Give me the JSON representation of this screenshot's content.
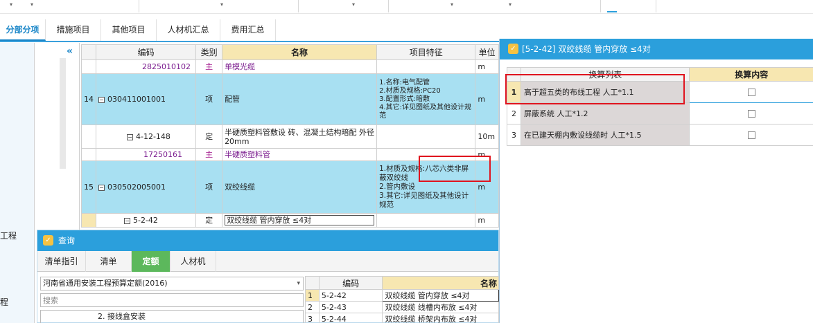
{
  "tabs": [
    {
      "label": "分部分项",
      "active": true
    },
    {
      "label": "措施项目",
      "active": false
    },
    {
      "label": "其他项目",
      "active": false
    },
    {
      "label": "人材机汇总",
      "active": false
    },
    {
      "label": "费用汇总",
      "active": false
    }
  ],
  "left_nav": {
    "label_1": "工程",
    "label_2": "程",
    "collapse_glyph": "«"
  },
  "grid": {
    "headers": {
      "code": "编码",
      "category": "类别",
      "name": "名称",
      "feature": "项目特征",
      "unit": "单位"
    },
    "rows": [
      {
        "num": "",
        "code": "2825010102",
        "category": "主",
        "name": "单模光缆",
        "feature": "",
        "unit": "m"
      },
      {
        "num": "14",
        "code": "030411001001",
        "category": "项",
        "name": "配管",
        "feature": "1.名称:电气配管\n2.材质及规格:PC20\n3.配置形式:暗敷\n4.其它:详见图纸及其他设计规范",
        "unit": "m"
      },
      {
        "num": "",
        "code": "4-12-148",
        "category": "定",
        "name": "半硬质塑料管敷设 砖、混凝土结构暗配 外径20mm",
        "feature": "",
        "unit": "10m"
      },
      {
        "num": "",
        "code": "17250161",
        "category": "主",
        "name": "半硬质塑料管",
        "feature": "",
        "unit": "m"
      },
      {
        "num": "15",
        "code": "030502005001",
        "category": "项",
        "name": "双绞线缆",
        "feature": "1.材质及规格:八芯六类非屏蔽双绞线\n2.管内敷设\n3.其它:详见图纸及其他设计规范",
        "unit": "m"
      },
      {
        "num": "",
        "code": "5-2-42",
        "category": "定",
        "name": "双绞线缆 管内穿放 ≤4对",
        "feature": "",
        "unit": "m"
      }
    ]
  },
  "query_panel": {
    "title": "查询",
    "tabs": [
      {
        "label": "清单指引",
        "active": false
      },
      {
        "label": "清单",
        "active": false
      },
      {
        "label": "定额",
        "active": true
      },
      {
        "label": "人材机",
        "active": false
      }
    ],
    "library_select": "河南省通用安装工程预算定额(2016)",
    "search_placeholder": "搜索",
    "tree_item": "2. 接线盒安装",
    "headers": {
      "code": "编码",
      "name": "名称"
    },
    "rows": [
      {
        "num": "1",
        "code": "5-2-42",
        "name": "双绞线缆 管内穿放 ≤4对"
      },
      {
        "num": "2",
        "code": "5-2-43",
        "name": "双绞线缆 线槽内布放 ≤4对"
      },
      {
        "num": "3",
        "code": "5-2-44",
        "name": "双绞线缆 桥架内布放 ≤4对"
      }
    ]
  },
  "dialog": {
    "title": "[5-2-42] 双绞线缆 管内穿放 ≤4对",
    "headers": {
      "list": "换算列表",
      "content": "换算内容"
    },
    "rows": [
      {
        "num": "1",
        "text": "高于超五类的布线工程 人工*1.1",
        "checked": false
      },
      {
        "num": "2",
        "text": "屏蔽系统 人工*1.2",
        "checked": false
      },
      {
        "num": "3",
        "text": "在已建天棚内敷设线缆时 人工*1.5",
        "checked": false
      }
    ]
  },
  "colors": {
    "accent_blue": "#2b9fdc",
    "row_blue": "#a8e0f2",
    "highlight_yellow": "#f7e7b1",
    "annotation_red": "#e0141e",
    "material_purple": "#7a1a8e",
    "active_green": "#5cb85c"
  }
}
